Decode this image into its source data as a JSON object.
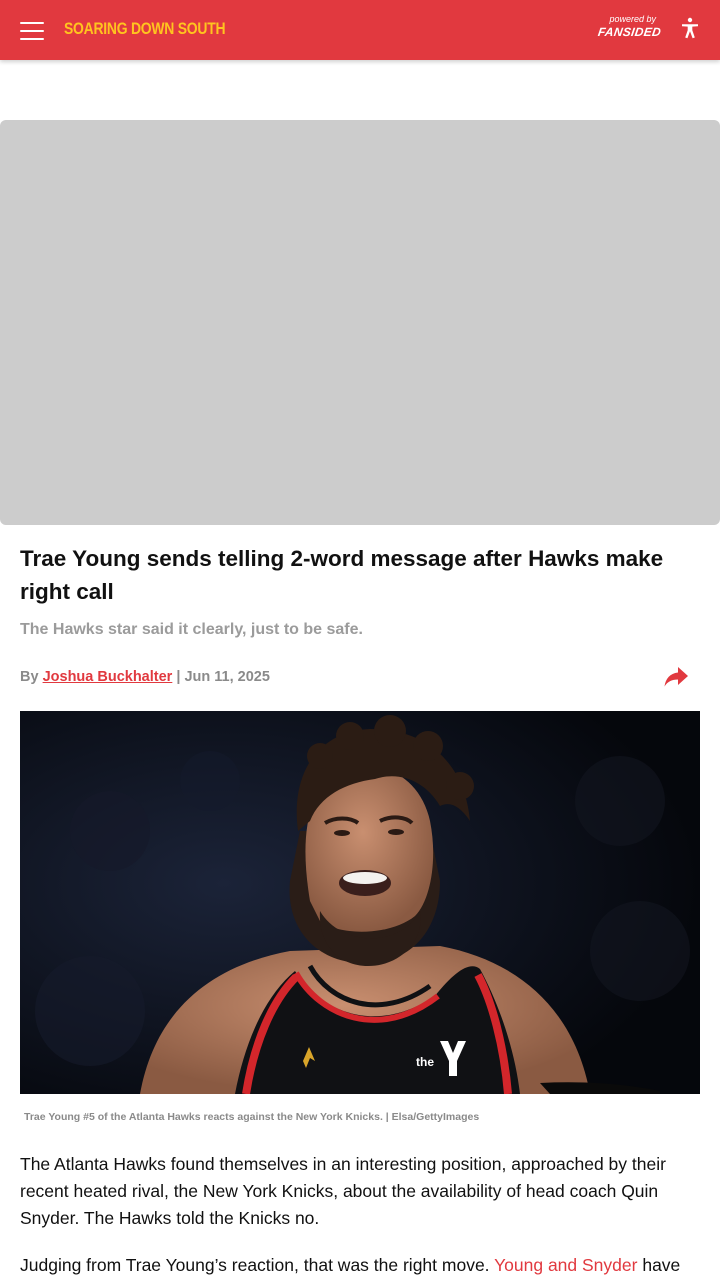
{
  "header": {
    "site_name": "SOARING DOWN SOUTH",
    "powered_by": "powered by",
    "network": "FANSIDED",
    "menu_icon": "hamburger-menu-icon",
    "accessibility_icon": "accessibility-icon",
    "colors": {
      "bar": "#e1393f",
      "logo": "#ffc41f"
    }
  },
  "ad": {
    "color": "#cccccc"
  },
  "article": {
    "headline": "Trae Young sends telling 2-word message after Hawks make right call",
    "subheadline": "The Hawks star said it clearly, just to be safe.",
    "byline": {
      "prefix": "By",
      "author": "Joshua Buckhalter",
      "separator": "|",
      "date": "Jun 11, 2025",
      "share_icon": "share-arrow-icon"
    },
    "image": {
      "jersey_logo_text": "the"
    },
    "caption": "Trae Young #5 of the Atlanta Hawks reacts against the New York Knicks. | Elsa/GettyImages",
    "paragraphs": [
      "The Atlanta Hawks found themselves in an interesting position, approached by their recent heated rival, the New York Knicks, about the availability of head coach Quin Snyder. The Hawks told the Knicks no."
    ],
    "paragraph2": {
      "before_link": "Judging from Trae Young’s reaction, that was the right move. ",
      "link": "Young and Snyder",
      "after_link": " have"
    },
    "link_color": "#e1393f"
  }
}
